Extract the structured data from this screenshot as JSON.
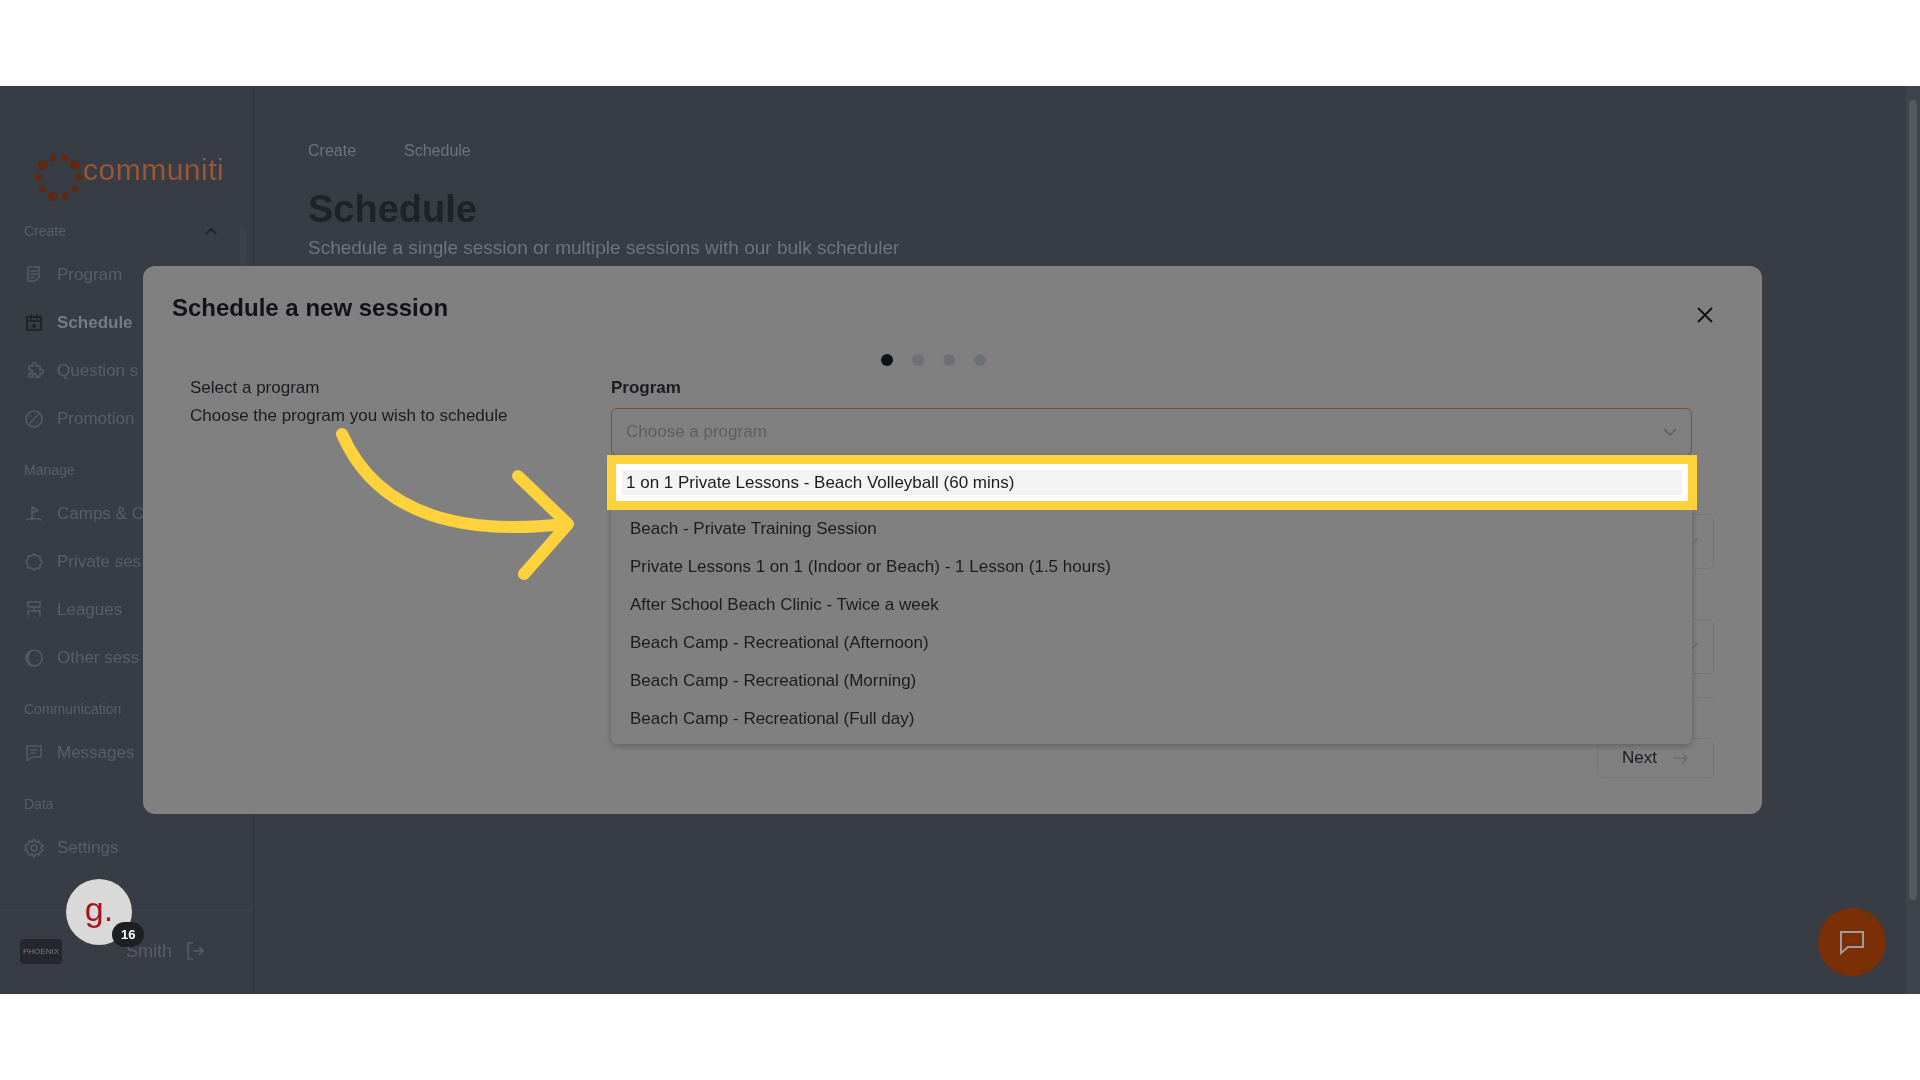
{
  "sidebar": {
    "logo_text": "communiti",
    "sections": [
      {
        "title": "Create",
        "expanded": true,
        "items": [
          {
            "label": "Program",
            "selected": false
          },
          {
            "label": "Schedule",
            "selected": true
          },
          {
            "label": "Question s",
            "selected": false
          },
          {
            "label": "Promotion",
            "selected": false
          }
        ]
      },
      {
        "title": "Manage",
        "items": [
          {
            "label": "Camps & C",
            "selected": false
          },
          {
            "label": "Private ses",
            "selected": false
          },
          {
            "label": "Leagues",
            "selected": false
          },
          {
            "label": "Other sess",
            "selected": false
          }
        ]
      },
      {
        "title": "Communication",
        "items": [
          {
            "label": "Messages",
            "selected": false
          }
        ]
      },
      {
        "title": "Data",
        "items": [
          {
            "label": "Settings",
            "selected": false
          }
        ]
      }
    ],
    "user": {
      "team_logo_text": "PHOENIX",
      "name": "Smith",
      "avatar_letter": "g.",
      "badge": "16"
    }
  },
  "breadcrumb": [
    "Create",
    "Schedule"
  ],
  "page": {
    "title": "Schedule",
    "subtitle": "Schedule a single session or multiple sessions with our bulk scheduler"
  },
  "modal": {
    "title": "Schedule a new session",
    "steps": [
      {
        "selected": true
      },
      {
        "selected": false
      },
      {
        "selected": false
      },
      {
        "selected": false
      }
    ],
    "step_title": "Select a program",
    "step_description": "Choose the program you wish to schedule",
    "field": {
      "label": "Program",
      "placeholder": "Choose a program",
      "expanded": true
    },
    "options": [
      {
        "label": "1 on 1 Private Lessons - Beach Volleyball (60 mins)",
        "highlighted": true
      },
      {
        "label": "Beach - Private Training Session",
        "highlighted": false
      },
      {
        "label": "Private Lessons 1 on 1 (Indoor or Beach) - 1 Lesson (1.5 hours)",
        "highlighted": false
      },
      {
        "label": "After School Beach Clinic - Twice a week",
        "highlighted": false
      },
      {
        "label": "Beach Camp - Recreational (Afternoon)",
        "highlighted": false
      },
      {
        "label": "Beach Camp - Recreational (Morning)",
        "highlighted": false
      },
      {
        "label": "Beach Camp - Recreational (Full day)",
        "highlighted": false
      }
    ],
    "next_button": "Next"
  }
}
